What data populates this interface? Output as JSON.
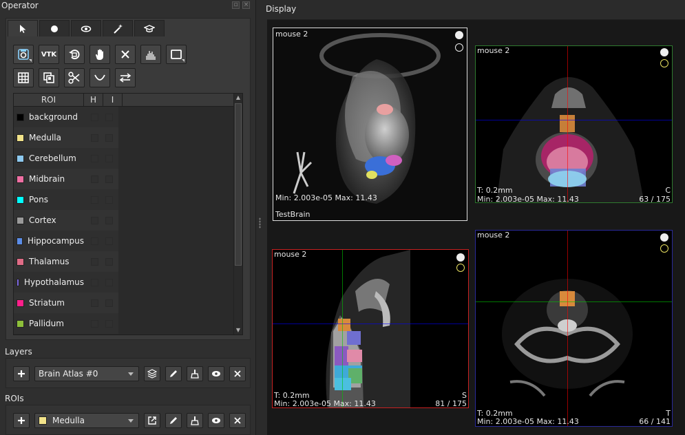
{
  "operator": {
    "title": "Operator",
    "tabs": [
      {
        "name": "pointer",
        "icon": "pointer-icon"
      },
      {
        "name": "circle",
        "icon": "circle-icon"
      },
      {
        "name": "eye",
        "icon": "eye-icon"
      },
      {
        "name": "wand",
        "icon": "magic-wand-icon"
      },
      {
        "name": "learn",
        "icon": "graduation-cap-icon"
      }
    ],
    "toolbar_row1": [
      {
        "icon": "save-image-icon"
      },
      {
        "icon": "vtk-icon",
        "label": "VTK"
      },
      {
        "icon": "rotate-icon"
      },
      {
        "icon": "hand-icon"
      },
      {
        "icon": "close-icon"
      },
      {
        "icon": "histogram-icon"
      },
      {
        "icon": "rectangle-icon"
      }
    ],
    "toolbar_row2": [
      {
        "icon": "table-icon"
      },
      {
        "icon": "layers-copy-icon"
      },
      {
        "icon": "scissors-icon"
      },
      {
        "icon": "curve-icon"
      },
      {
        "icon": "swap-icon"
      }
    ]
  },
  "roi_table": {
    "headers": [
      "ROI",
      "H",
      "I"
    ],
    "rows": [
      {
        "name": "background",
        "color": "#000000"
      },
      {
        "name": "Medulla",
        "color": "#f2e38a"
      },
      {
        "name": "Cerebellum",
        "color": "#8dc9f0"
      },
      {
        "name": "Midbrain",
        "color": "#ef6fa3"
      },
      {
        "name": "Pons",
        "color": "#00ffff"
      },
      {
        "name": "Cortex",
        "color": "#9a9a9a"
      },
      {
        "name": "Hippocampus",
        "color": "#5b8de8"
      },
      {
        "name": "Thalamus",
        "color": "#e06c86"
      },
      {
        "name": "Hypothalamus",
        "color": "#7b67e0"
      },
      {
        "name": "Striatum",
        "color": "#ff1f8b"
      },
      {
        "name": "Pallidum",
        "color": "#8dbf3a"
      }
    ]
  },
  "layers": {
    "label": "Layers",
    "selected": "Brain Atlas #0"
  },
  "rois": {
    "label": "ROIs",
    "selected": "Medulla",
    "selected_color": "#f2e38a"
  },
  "display": {
    "title": "Display",
    "views": {
      "render3d": {
        "title": "mouse 2",
        "minmax": "Min: 2.003e-05 Max: 11.43",
        "name": "TestBrain"
      },
      "coronal": {
        "title": "mouse 2",
        "thickness": "T: 0.2mm",
        "minmax": "Min: 2.003e-05 Max: 11.43",
        "orient": "C",
        "slice": "63 / 175"
      },
      "sagittal": {
        "title": "mouse 2",
        "thickness": "T: 0.2mm",
        "minmax": "Min: 2.003e-05 Max: 11.43",
        "orient": "S",
        "slice": "81 / 175"
      },
      "transverse": {
        "title": "mouse 2",
        "thickness": "T: 0.2mm",
        "minmax": "Min: 2.003e-05 Max: 11.43",
        "orient": "T",
        "slice": "66 / 141"
      }
    }
  }
}
